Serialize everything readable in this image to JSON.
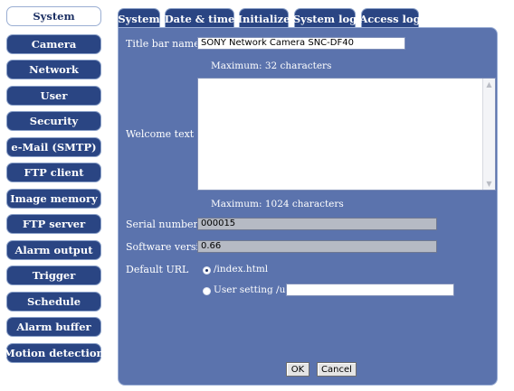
{
  "sidebar": {
    "items": [
      {
        "label": "System"
      },
      {
        "label": "Camera"
      },
      {
        "label": "Network"
      },
      {
        "label": "User"
      },
      {
        "label": "Security"
      },
      {
        "label": "e-Mail (SMTP)"
      },
      {
        "label": "FTP client"
      },
      {
        "label": "Image memory"
      },
      {
        "label": "FTP server"
      },
      {
        "label": "Alarm output"
      },
      {
        "label": "Trigger"
      },
      {
        "label": "Schedule"
      },
      {
        "label": "Alarm buffer"
      },
      {
        "label": "Motion detection"
      }
    ],
    "active": "System"
  },
  "tabs": [
    {
      "label": "System"
    },
    {
      "label": "Date & time"
    },
    {
      "label": "Initialize"
    },
    {
      "label": "System log"
    },
    {
      "label": "Access log"
    }
  ],
  "form": {
    "title_bar_name": {
      "label": "Title bar name",
      "value": "SONY Network Camera SNC-DF40",
      "hint": "Maximum: 32 characters"
    },
    "welcome_text": {
      "label": "Welcome text",
      "value": "",
      "hint": "Maximum: 1024 characters"
    },
    "serial_number": {
      "label": "Serial number",
      "value": "000015"
    },
    "software_version": {
      "label": "Software version",
      "value": "0.66"
    },
    "default_url": {
      "label": "Default URL",
      "options": [
        {
          "label": "/index.html",
          "checked": true
        },
        {
          "label": "User setting /user/",
          "checked": false
        }
      ],
      "user_value": ""
    }
  },
  "buttons": {
    "ok": "OK",
    "cancel": "Cancel"
  },
  "colors": {
    "nav_bg": "#2a4583",
    "panel_bg": "#5b73ad",
    "active_bg": "#ffffff"
  }
}
